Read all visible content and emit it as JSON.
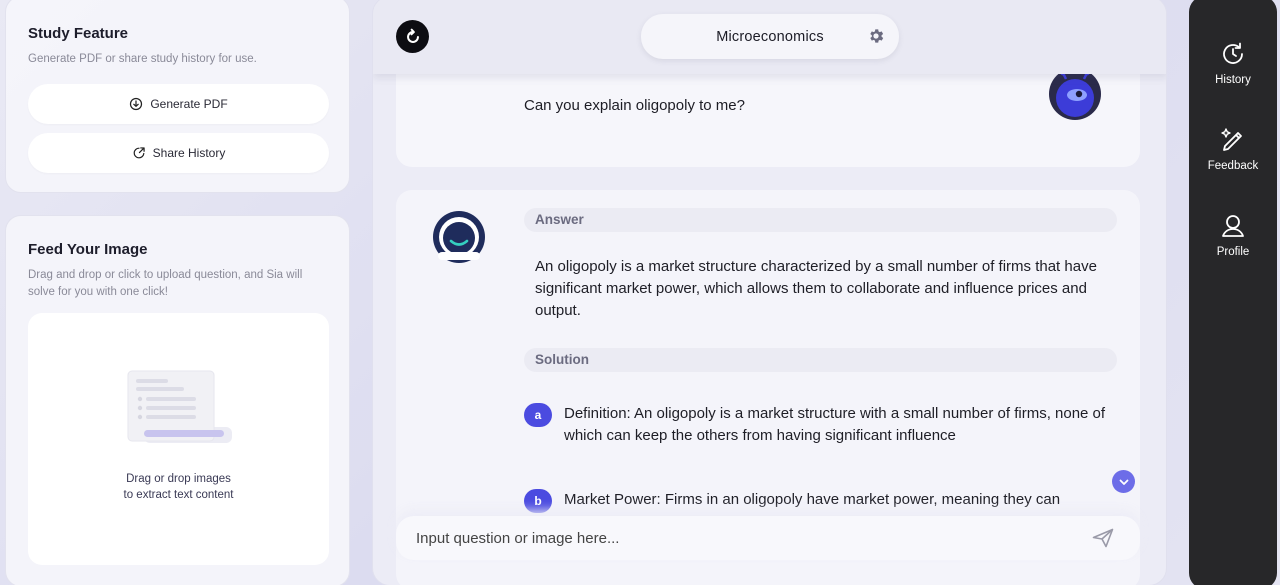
{
  "study": {
    "title": "Study Feature",
    "subtitle": "Generate PDF or share study history for use.",
    "generate_pdf": "Generate PDF",
    "share_history": "Share History"
  },
  "feed": {
    "title": "Feed Your Image",
    "subtitle": "Drag and drop or click to upload question, and Sia will solve for you with one click!",
    "drop_line1": "Drag or drop images",
    "drop_line2": "to extract text content"
  },
  "chat": {
    "subject": "Microeconomics",
    "user_question": "Can you explain oligopoly to me?",
    "answer_label": "Answer",
    "answer_text": "An oligopoly is a market structure characterized by a small number of firms that have significant market power, which allows them to collaborate and influence prices and output.",
    "solution_label": "Solution",
    "steps": [
      {
        "badge": "a",
        "text": "Definition: An oligopoly is a market structure with a small number of firms, none of which can keep the others from having significant influence"
      },
      {
        "badge": "b",
        "text": "Market Power: Firms in an oligopoly have market power, meaning they can"
      }
    ],
    "input_placeholder": "Input question or image here..."
  },
  "nav": {
    "history": "History",
    "feedback": "Feedback",
    "profile": "Profile"
  },
  "colors": {
    "accent": "#4b4be0",
    "sidebar_bg": "#272729",
    "avatar_user": "#3c3cd8",
    "avatar_ai": "#1f2c5c"
  }
}
